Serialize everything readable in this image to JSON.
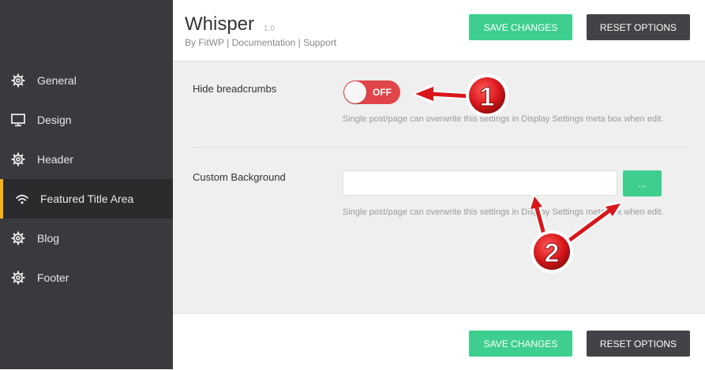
{
  "header": {
    "title": "Whisper",
    "version": "1.0",
    "by": "By FitWP",
    "separator": "|",
    "documentation": "Documentation",
    "support": "Support",
    "save_label": "SAVE CHANGES",
    "reset_label": "RESET OPTIONS"
  },
  "sidebar": {
    "items": [
      {
        "label": "General",
        "icon": "gear-icon"
      },
      {
        "label": "Design",
        "icon": "monitor-icon"
      },
      {
        "label": "Header",
        "icon": "gear-icon"
      },
      {
        "label": "Featured Title Area",
        "icon": "wifi-icon",
        "active": true
      },
      {
        "label": "Blog",
        "icon": "gear-icon"
      },
      {
        "label": "Footer",
        "icon": "gear-icon"
      }
    ]
  },
  "settings": {
    "hide_breadcrumbs": {
      "label": "Hide breadcrumbs",
      "toggle_text": "OFF",
      "description": "Single post/page can overwrite this settings in Display Settings meta box when edit."
    },
    "custom_background": {
      "label": "Custom Background",
      "value": "",
      "browse_label": "...",
      "description": "Single post/page can overwrite this settings in Display Settings meta box when edit."
    }
  },
  "footer": {
    "save_label": "SAVE CHANGES",
    "reset_label": "RESET OPTIONS"
  },
  "annotations": [
    {
      "number": "1"
    },
    {
      "number": "2"
    }
  ],
  "colors": {
    "sidebar_bg": "#3a3a3e",
    "active_bg": "#2b2b2e",
    "active_accent": "#f5b21a",
    "save_button": "#3ecf8e",
    "reset_button": "#434347",
    "toggle_off": "#e0454a",
    "callout_red": "#d8171b"
  }
}
